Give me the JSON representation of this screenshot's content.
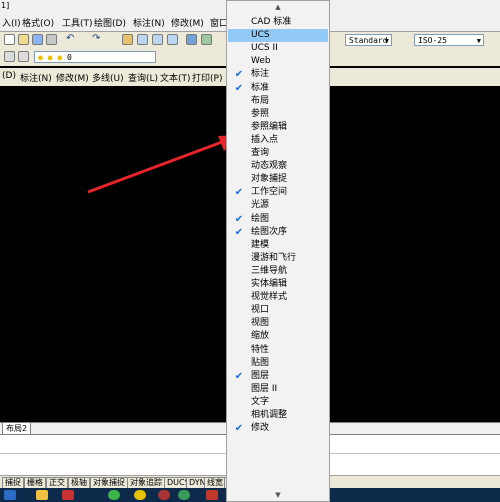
{
  "app": {
    "title_fragment": "1]"
  },
  "menubar": {
    "items": [
      "入(I)",
      "格式(O)",
      "工具(T)",
      "绘图(D)",
      "标注(N)",
      "修改(M)",
      "窗口"
    ]
  },
  "toolbar1": {
    "text_style": "Standard",
    "dim_style": "ISO-25"
  },
  "toolbar2": {
    "layer_value": "0"
  },
  "toolbar3": {
    "items": [
      "(D)",
      "标注(N)",
      "修改(M)",
      "多线(U)",
      "查询(L)",
      "文本(T)",
      "打印(P)"
    ]
  },
  "layout_tabs": {
    "label": "布局2"
  },
  "statusbar": {
    "buttons": [
      "捕捉",
      "栅格",
      "正交",
      "极轴",
      "对象捕捉",
      "对象追踪",
      "DUCS",
      "DYN",
      "线宽",
      "模"
    ]
  },
  "toolbar_menu": {
    "items": [
      {
        "label": "CAD 标准",
        "checked": false
      },
      {
        "label": "UCS",
        "checked": false,
        "highlighted": true
      },
      {
        "label": "UCS II",
        "checked": false
      },
      {
        "label": "Web",
        "checked": false
      },
      {
        "label": "标注",
        "checked": true
      },
      {
        "label": "标准",
        "checked": true
      },
      {
        "label": "布局",
        "checked": false
      },
      {
        "label": "参照",
        "checked": false
      },
      {
        "label": "参照编辑",
        "checked": false
      },
      {
        "label": "插入点",
        "checked": false
      },
      {
        "label": "查询",
        "checked": false
      },
      {
        "label": "动态观察",
        "checked": false
      },
      {
        "label": "对象捕捉",
        "checked": false
      },
      {
        "label": "工作空间",
        "checked": true
      },
      {
        "label": "光源",
        "checked": false
      },
      {
        "label": "绘图",
        "checked": true
      },
      {
        "label": "绘图次序",
        "checked": true
      },
      {
        "label": "建模",
        "checked": false
      },
      {
        "label": "漫游和飞行",
        "checked": false
      },
      {
        "label": "三维导航",
        "checked": false
      },
      {
        "label": "实体编辑",
        "checked": false
      },
      {
        "label": "视觉样式",
        "checked": false
      },
      {
        "label": "视口",
        "checked": false
      },
      {
        "label": "视图",
        "checked": false
      },
      {
        "label": "缩放",
        "checked": false
      },
      {
        "label": "特性",
        "checked": false
      },
      {
        "label": "贴图",
        "checked": false
      },
      {
        "label": "图层",
        "checked": true
      },
      {
        "label": "图层 II",
        "checked": false
      },
      {
        "label": "文字",
        "checked": false
      },
      {
        "label": "相机调整",
        "checked": false
      },
      {
        "label": "修改",
        "checked": true
      }
    ],
    "check_glyph": "✔",
    "scroll_up": "▲",
    "scroll_down": "▼"
  },
  "colors": {
    "canvas": "#000000",
    "highlight": "#91c9f7",
    "check": "#1e6fd9",
    "arrow": "#e8242a"
  }
}
